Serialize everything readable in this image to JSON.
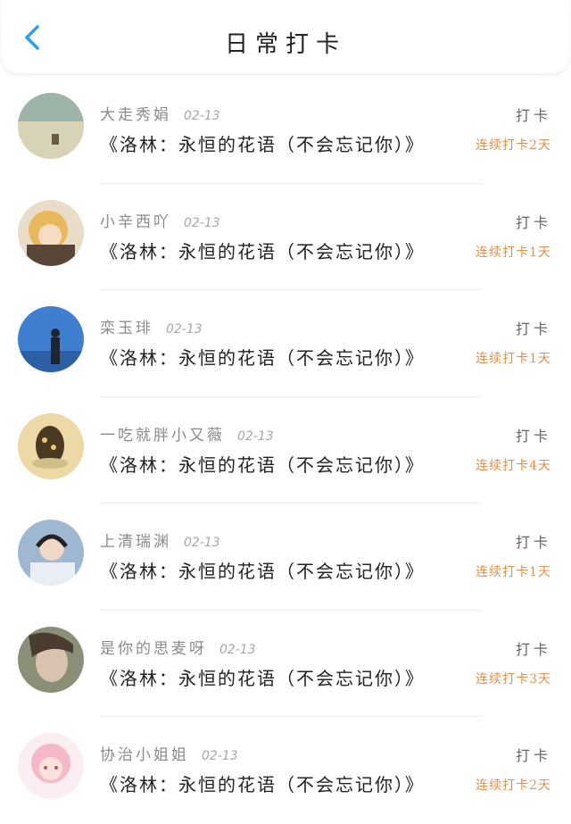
{
  "header": {
    "title": "日常打卡",
    "back_icon": "chevron-left-icon",
    "accent_color": "#2a9df4"
  },
  "entries": [
    {
      "username": "大走秀娟",
      "date": "02-13",
      "book": "《洛林：永恒的花语（不会忘记你）》",
      "action": "打卡",
      "streak": "连续打卡2天",
      "avatar": "landscape-avatar"
    },
    {
      "username": "小辛西吖",
      "date": "02-13",
      "book": "《洛林：永恒的花语（不会忘记你）》",
      "action": "打卡",
      "streak": "连续打卡1天",
      "avatar": "anime-character-avatar"
    },
    {
      "username": "栾玉琲",
      "date": "02-13",
      "book": "《洛林：永恒的花语（不会忘记你）》",
      "action": "打卡",
      "streak": "连续打卡1天",
      "avatar": "blue-sky-person-avatar"
    },
    {
      "username": "一吃就胖小又薇",
      "date": "02-13",
      "book": "《洛林：永恒的花语（不会忘记你）》",
      "action": "打卡",
      "streak": "连续打卡4天",
      "avatar": "illustration-avatar"
    },
    {
      "username": "上清瑞渊",
      "date": "02-13",
      "book": "《洛林：永恒的花语（不会忘记你）》",
      "action": "打卡",
      "streak": "连续打卡1天",
      "avatar": "headphones-person-avatar"
    },
    {
      "username": "是你的思麦呀",
      "date": "02-13",
      "book": "《洛林：永恒的花语（不会忘记你）》",
      "action": "打卡",
      "streak": "连续打卡3天",
      "avatar": "portrait-avatar"
    },
    {
      "username": "协治小姐姐",
      "date": "02-13",
      "book": "《洛林：永恒的花语（不会忘记你）》",
      "action": "打卡",
      "streak": "连续打卡2天",
      "avatar": "pink-anime-avatar"
    }
  ],
  "colors": {
    "streak": "#e4904a",
    "divider": "#ededed"
  }
}
